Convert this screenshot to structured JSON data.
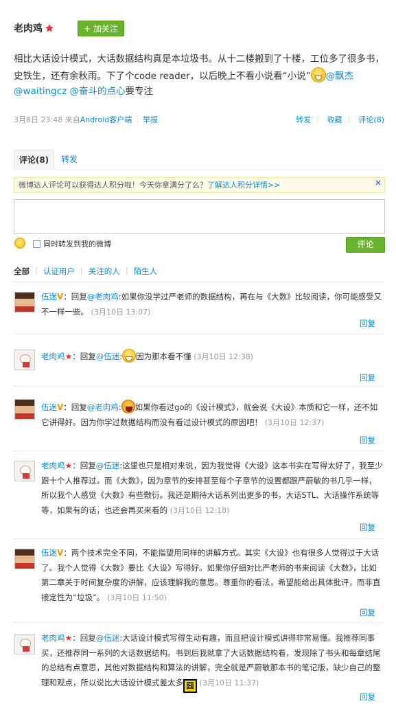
{
  "header": {
    "username": "老肉鸡",
    "follow_label": "+ 加关注"
  },
  "post": {
    "text_part1": "相比大话设计模式，大话数据结构真是本垃圾书。从十二楼搬到了十楼，工位多了很多书，史铁生，还有余秋雨。下了个code reader，以后晚上不看小说看“小说”",
    "mention1": "@飘杰",
    "mention2": "@waitingcz",
    "mention3": "@奋斗的点心",
    "text_part2": "要专注"
  },
  "meta": {
    "time": "3月8日 23:48",
    "from_prefix": "来自",
    "source": "Android客户端",
    "report": "举报",
    "repost": "转发",
    "favorite": "收藏",
    "comment": "评论(8)"
  },
  "tabs": {
    "comments": "评论(8)",
    "reposts": "转发"
  },
  "notice": {
    "text": "微博达人评论可以获得达人积分啦！今天你拿满分了么？",
    "link": "了解达人积分详情>>",
    "close": "×"
  },
  "composer": {
    "repost_label": "同时转发到我的微博",
    "submit_label": "评论"
  },
  "filters": {
    "all": "全部",
    "verified": "认证用户",
    "following": "关注的人",
    "strangers": "陌生人"
  },
  "comments": [
    {
      "user": "伍迷",
      "reply_to": "@老肉鸡",
      "text": ":如果你没学过严老师的数据结构，再在与《大数》比较阅读，你可能感受又不一样一些。",
      "time": "(3月10日 13:07)",
      "reply": "回复"
    },
    {
      "user": "老肉鸡",
      "reply_to": "@伍迷",
      "text": "因为那本看不懂",
      "time": "(3月10日 12:38)",
      "reply": "回复"
    },
    {
      "user": "伍迷",
      "reply_to": "@老肉鸡",
      "text": "如果你看过go的《设计模式》，就会说《大设》本质和它一样，还不如它讲得好。因为你学过数据结构而没有看过设计模式的原因吧！",
      "time": "(3月10日 12:37)",
      "reply": "回复"
    },
    {
      "user": "老肉鸡",
      "reply_to": "@伍迷",
      "text": ":这里也只是相对来说，因为我觉得《大设》这本书实在写得太好了，我至少跟十个人推荐过。而《大数》，因为章节的安排甚至每个子章节的设置都跟严蔚敏的书几乎一样，所以我个人感觉《大数》有些敷衍。我还是期待大话系列出更多的书，大话STL、大话操作系统等等，如果有的话，也还会再买来看的",
      "time": "(3月10日 12:18)",
      "reply": "回复"
    },
    {
      "user": "伍迷",
      "text": "两个技术完全不同，不能指望用同样的讲解方式。其实《大设》也有很多人觉得过于大话了。我个人觉得《大数》要比《大设》写得好。如果你仔细对比严老师的书来阅读《大数》，比如第二章关于时间复杂度的讲解，应该理解我的意思。尊重你的看法，希望能给出具体批评，而非直接定性为“垃圾”。",
      "time": "(3月10日 11:50)",
      "reply": "回复"
    },
    {
      "user": "老肉鸡",
      "reply_to": "@伍迷",
      "text": ":大话设计模式写得生动有趣，而且把设计模式讲得非常易懂。我推荐同事买，还推荐同一系列的大话数据结构。书到后我就拿了大话数据结构看，发现除了书头和每章结尾的总结有点意思，其他对数据结构和算法的讲解，完全就是严蔚敏那本书的笔记版，缺少自己的整理和观点，所以说比大话设计模式差太多",
      "time": "(3月10日 11:37)",
      "reply": "回复"
    }
  ],
  "emoji_tai": "囧"
}
